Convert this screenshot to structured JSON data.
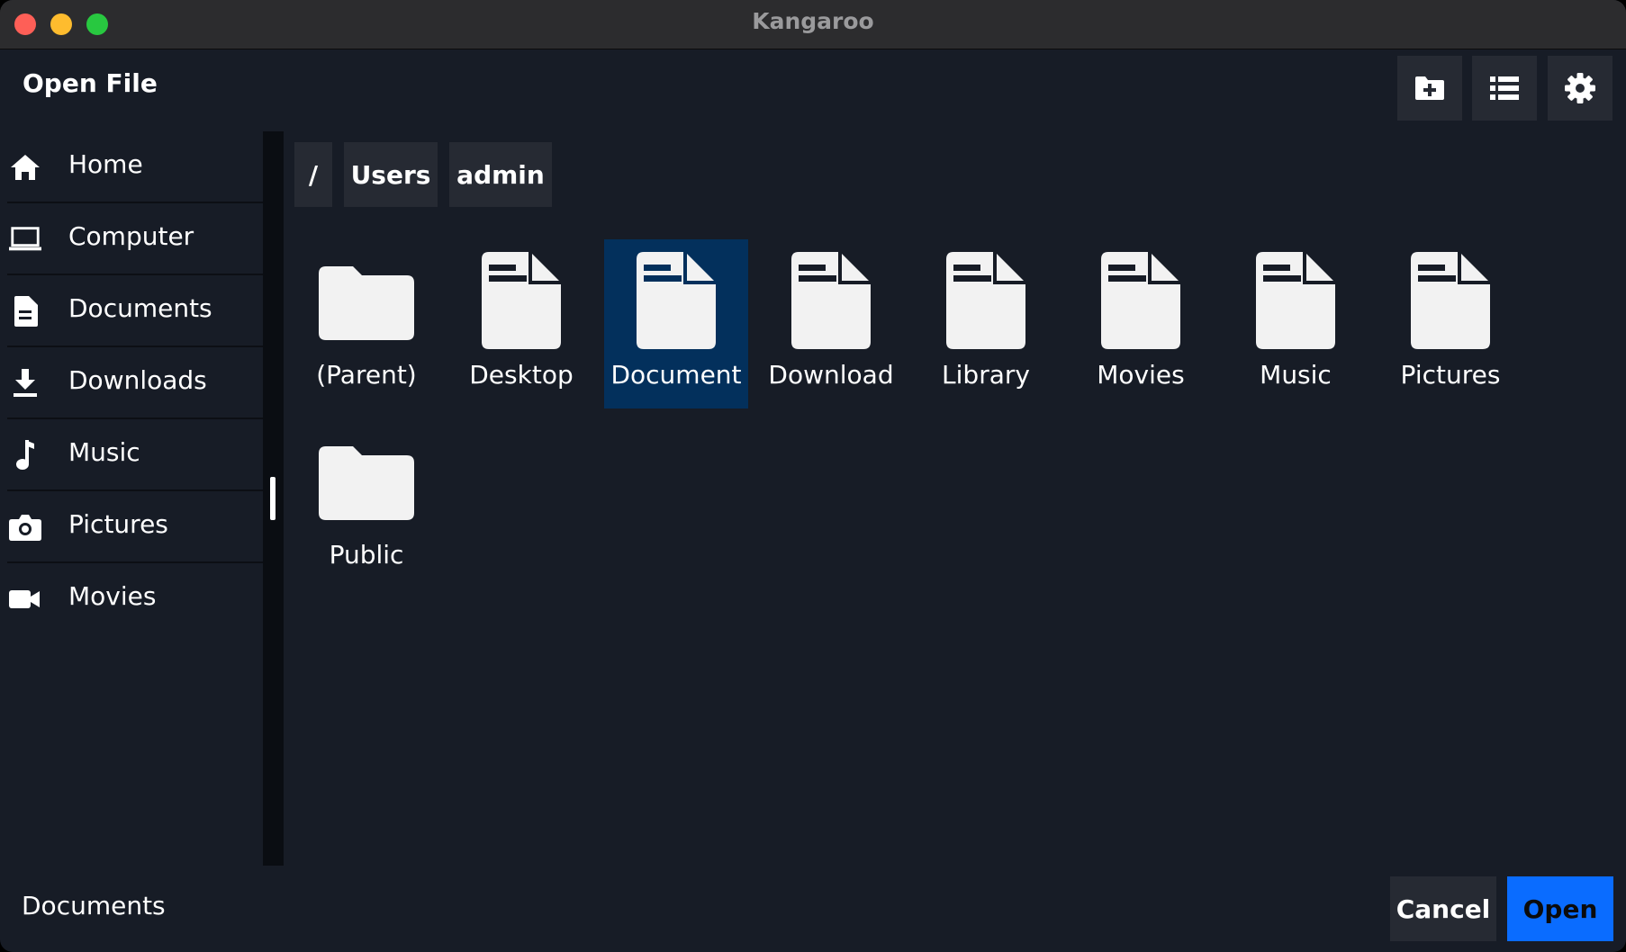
{
  "window": {
    "title": "Kangaroo"
  },
  "header": {
    "title": "Open File"
  },
  "toolbar": {
    "icons": [
      "new-folder-icon",
      "list-view-icon",
      "gear-icon"
    ]
  },
  "sidebar": {
    "items": [
      {
        "label": "Home",
        "icon": "home-icon"
      },
      {
        "label": "Computer",
        "icon": "laptop-icon"
      },
      {
        "label": "Documents",
        "icon": "document-icon"
      },
      {
        "label": "Downloads",
        "icon": "download-icon"
      },
      {
        "label": "Music",
        "icon": "music-note-icon"
      },
      {
        "label": "Pictures",
        "icon": "camera-icon"
      },
      {
        "label": "Movies",
        "icon": "video-camera-icon"
      }
    ]
  },
  "breadcrumb": [
    "/",
    "Users",
    "admin"
  ],
  "files": [
    {
      "label": "(Parent)",
      "type": "folder"
    },
    {
      "label": "Desktop",
      "type": "file"
    },
    {
      "label": "Document",
      "type": "file",
      "selected": true
    },
    {
      "label": "Download",
      "type": "file"
    },
    {
      "label": "Library",
      "type": "file"
    },
    {
      "label": "Movies",
      "type": "file"
    },
    {
      "label": "Music",
      "type": "file"
    },
    {
      "label": "Pictures",
      "type": "file"
    },
    {
      "label": "Public",
      "type": "folder"
    }
  ],
  "footer": {
    "current_folder": "Documents",
    "cancel_label": "Cancel",
    "open_label": "Open"
  },
  "colors": {
    "background": "#171c26",
    "selection": "#03305c",
    "accent": "#0a6cff",
    "button": "#262a33"
  }
}
